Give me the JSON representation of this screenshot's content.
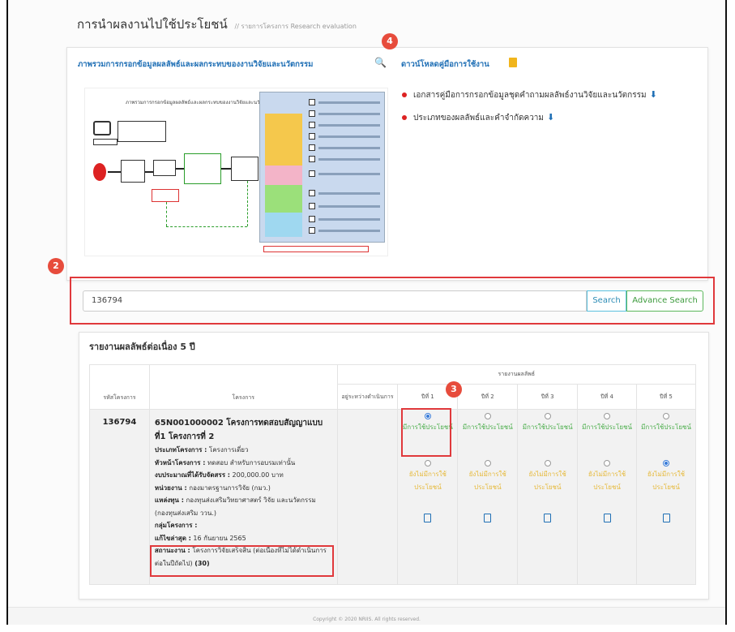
{
  "header": {
    "title": "การนำผลงานไปใช้ประโยชน์",
    "breadcrumb": "// รายการโครงการ Research evaluation"
  },
  "overview": {
    "link_label": "ภาพรวมการกรอกข้อมูลผลลัพธ์และผลกระทบของงานวิจัยและนวัตกรรม",
    "link_icon": "search-icon",
    "diagram_title": "ภาพรวมการกรอกข้อมูลผลลัพธ์และผลกระทบของงานวิจัยและนวัตกรรม"
  },
  "manual": {
    "link_label": "ดาวน์โหลดคู่มือการใช้งาน",
    "link_icon": "book-icon",
    "items": [
      {
        "label": "เอกสารคู่มือการกรอกข้อมูลชุดคำถามผลลัพธ์งานวิจัยและนวัตกรรม",
        "icon": "download-icon"
      },
      {
        "label": "ประเภทของผลลัพธ์และคำจำกัดความ",
        "icon": "download-icon"
      }
    ]
  },
  "callouts": {
    "four": "4",
    "two": "2",
    "three": "3"
  },
  "search": {
    "value": "136794",
    "search_label": "Search",
    "advance_label": "Advance Search"
  },
  "report": {
    "title": "รายงานผลลัพธ์ต่อเนื่อง 5 ปี",
    "group_header": "รายงานผลลัพธ์",
    "col_code": "รหัสโครงการ",
    "col_project": "โครงการ",
    "col_in_progress": "อยู่ระหว่างดำเนินการ",
    "years": [
      "ปีที่ 1",
      "ปีที่ 2",
      "ปีที่ 3",
      "ปีที่ 4",
      "ปีที่ 5"
    ],
    "row": {
      "code": "136794",
      "title": "65N001000002 โครงการทดสอบสัญญาแบบที่1 โครงการที่ 2",
      "type_label": "ประเภทโครงการ :",
      "type_value": "โครงการเดี่ยว",
      "lead_label": "หัวหน้าโครงการ :",
      "lead_value": "ทดสอบ สำหรับการอบรมเท่านั้น",
      "budget_label": "งบประมาณที่ได้รับจัดสรร :",
      "budget_value": "200,000.00 บาท",
      "unit_label": "หน่วยงาน :",
      "unit_value": "กองมาตรฐานการวิจัย (กมว.)",
      "fund_label": "แหล่งทุน :",
      "fund_value": "กองทุนส่งเสริมวิทยาศาสตร์ วิจัย และนวัตกรรม (กองทุนส่งเสริม ววน.)",
      "group_label": "กลุ่มโครงการ :",
      "group_value": "",
      "edited_label": "แก้ไขล่าสุด :",
      "edited_value": "16 กันยายน 2565",
      "status_label": "สถานะงาน :",
      "status_value": "โครงการวิจัยเสร็จสิ้น (ต่อเนื่องที่ไม่ได้ดำเนินการต่อในปีถัดไป)",
      "status_code": "(30)"
    },
    "option_used": "มีการใช้ประโยชน์",
    "option_not_used": "ยังไม่มีการใช้ประโยชน์",
    "year_selection": [
      "used",
      "none",
      "none",
      "none",
      "not_used"
    ]
  },
  "footer": {
    "text": "Copyright © 2020 NRIIS. All rights reserved."
  }
}
